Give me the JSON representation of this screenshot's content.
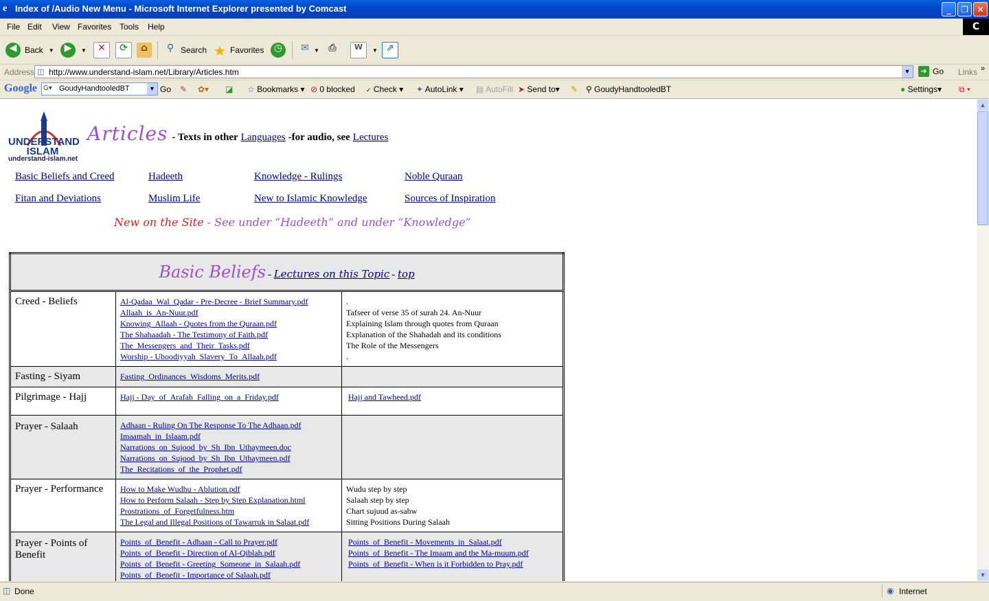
{
  "window": {
    "title": "Index of /Audio New Menu - Microsoft Internet Explorer presented by Comcast"
  },
  "menu": {
    "items": [
      "File",
      "Edit",
      "View",
      "Favorites",
      "Tools",
      "Help"
    ],
    "brand": "C"
  },
  "toolbar": {
    "back": "Back",
    "search": "Search",
    "favorites": "Favorites"
  },
  "address": {
    "label": "Address",
    "url": "http://www.understand-islam.net/Library/Articles.htm",
    "go": "Go",
    "links": "Links"
  },
  "google": {
    "logo": "Google",
    "search_value": "GoudyHandtooledBT",
    "go": "Go",
    "bookmarks": "Bookmarks",
    "blocked": "0 blocked",
    "check": "Check",
    "autolink": "AutoLink",
    "autofill": "AutoFill",
    "sendto": "Send to",
    "highlight": "GoudyHandtooledBT",
    "settings": "Settings"
  },
  "page": {
    "logo_text": "UNDERSTAND ISLAM",
    "logo_url": "understand-islam.net",
    "heading": "Articles",
    "subheading_part1": "- Texts in other",
    "languages_link": "Languages",
    "subheading_part2": "-for audio, see",
    "lectures_link": "Lectures",
    "nav": [
      "Basic Beliefs and Creed",
      "Hadeeth",
      "Knowledge - Rulings",
      "Noble Quraan",
      "Fitan and Deviations",
      "Muslim Life",
      "New to Islamic Knowledge",
      "Sources of Inspiration"
    ],
    "new_on_site": "New on the Site",
    "new_note": " - See under “Hadeeth” and under “Knowledge”",
    "section_title": "Basic Beliefs",
    "section_lectures": "Lectures on this Topic",
    "section_top": "top",
    "rows": [
      {
        "cat": "Creed - Beliefs",
        "files": [
          "Al-Qadaa_Wal_Qadar - Pre-Decree - Brief Summary.pdf",
          "Allaah_is_An-Nuur.pdf",
          "Knowing_Allaah - Quotes from the Quraan.pdf",
          "The Shahaadah - The Testimony of Faith.pdf",
          "The_Messengers_and_Their_Tasks.pdf",
          "Worship - Uboodiyyah_Slavery_To_Allaah.pdf"
        ],
        "desc": [
          ".",
          "Tafseer of verse 35 of surah 24. An-Nuur",
          "Explaining Islam through quotes from Quraan",
          "Explanation of the Shahadah and its conditions",
          "The Role of the Messengers",
          "."
        ]
      },
      {
        "cat": "Fasting - Siyam",
        "files": [
          "Fasting_Ordinances_Wisdoms_Merits.pdf"
        ],
        "desc": []
      },
      {
        "cat": "Pilgrimage - Hajj",
        "files": [
          "Hajj - Day_of_Arafah_Falling_on_a_Friday.pdf"
        ],
        "desc_links": [
          "Hajj and Tawheed.pdf"
        ]
      },
      {
        "cat": "Prayer - Salaah",
        "files": [
          "Adhaan - Ruling On The Response To The Adhaan.pdf",
          "Imaamah_in_Islaam.pdf",
          "Narrations_on_Sujood_by_Sh_Ibn_Uthaymeen.doc",
          "Narrations_on_Sujood_by_Sh_Ibn_Uthaymeen.pdf",
          "The_Recitations_of_the_Prophet.pdf"
        ],
        "desc": []
      },
      {
        "cat": "Prayer - Performance",
        "files": [
          "How to Make Wudhu - Ablution.pdf",
          "How to Perform Salaah - Step by Step Explanation.html",
          "Prostrations_of_Forgetfulness.htm",
          "The Legal and Illegal Positions of Tawarruk in Salaat.pdf"
        ],
        "desc": [
          "Wudu step by step",
          "Salaah step by step",
          "Chart sujuud as-sahw",
          "Sitting Positions During Salaah"
        ]
      },
      {
        "cat": "Prayer - Points of Benefit",
        "files": [
          "Points_of_Benefit - Adhaan - Call to Prayer.pdf",
          "Points_of_Benefit - Direction of Al-Qiblah.pdf",
          "Points_of_Benefit - Greeting_Someone_in_Salaah.pdf",
          "Points_of_Benefit - Importance of Salaah.pdf"
        ],
        "desc_links": [
          "Points_of_Benefit - Movements_in_Salaat.pdf",
          "Points_of_Benefit - The Imaam and the Ma-muum.pdf",
          "Points_of_Benefit - When is it Forbidden to Pray.pdf"
        ]
      }
    ]
  },
  "status": {
    "text": "Done",
    "zone": "Internet"
  },
  "colors": {
    "titlebar": "#0a54d8",
    "link": "#00008b",
    "heading_purple": "#9b4fd9",
    "new_red": "#e02020"
  }
}
